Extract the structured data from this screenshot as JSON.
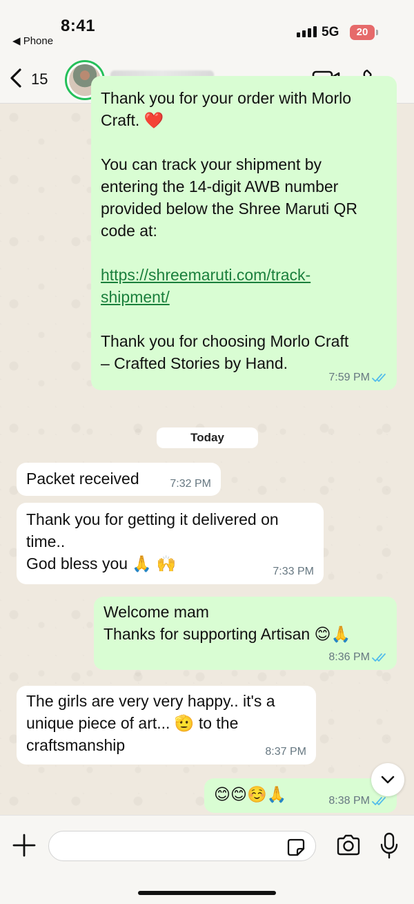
{
  "status_bar": {
    "time": "8:41",
    "back_app": "◀ Phone",
    "network": "5G",
    "battery": "20"
  },
  "header": {
    "back_count": "15",
    "contact_name": "",
    "icons": [
      "back-chevron-icon",
      "video-call-icon",
      "voice-call-icon"
    ]
  },
  "messages": [
    {
      "direction": "outgoing",
      "lines": [
        "Thank you for your order with Morlo",
        "Craft. ❤️",
        "",
        "You can track your shipment by",
        "entering the 14-digit AWB number",
        "provided below the Shree Maruti QR",
        "code at:"
      ],
      "link": "https://shreemaruti.com/track-shipment/",
      "link_line1": "https://shreemaruti.com/track-",
      "link_line2": "shipment/",
      "closing_line1": "Thank you for choosing Morlo Craft",
      "closing_line2": "– Crafted Stories by Hand.",
      "time": "7:59 PM",
      "read": true
    }
  ],
  "date_separator": "Today",
  "today_messages": [
    {
      "id": "m2",
      "direction": "incoming",
      "text": "Packet received",
      "time": "7:32 PM"
    },
    {
      "id": "m3",
      "direction": "incoming",
      "line1": "Thank you for getting it delivered on",
      "line2": "time..",
      "line3": "God bless you 🙏 🙌",
      "time": "7:33 PM"
    },
    {
      "id": "m4",
      "direction": "outgoing",
      "line1": "Welcome mam",
      "line2": "Thanks for supporting Artisan 😊🙏",
      "time": "8:36 PM",
      "read": true
    },
    {
      "id": "m5",
      "direction": "incoming",
      "line1": "The girls are very very happy.. it's a",
      "line2": "unique piece of art... 🫡 to the",
      "line3": "craftsmanship",
      "time": "8:37 PM"
    },
    {
      "id": "m6",
      "direction": "outgoing",
      "text": "😊😊☺️🙏",
      "time": "8:38 PM",
      "read": true
    }
  ],
  "input_bar": {
    "placeholder": "",
    "value": ""
  },
  "colors": {
    "outgoing_bubble": "#d9fdd3",
    "incoming_bubble": "#ffffff",
    "read_tick": "#53bdeb",
    "link": "#1a7f3c",
    "avatar_ring": "#25c05a",
    "battery_low": "#e66a6a"
  }
}
